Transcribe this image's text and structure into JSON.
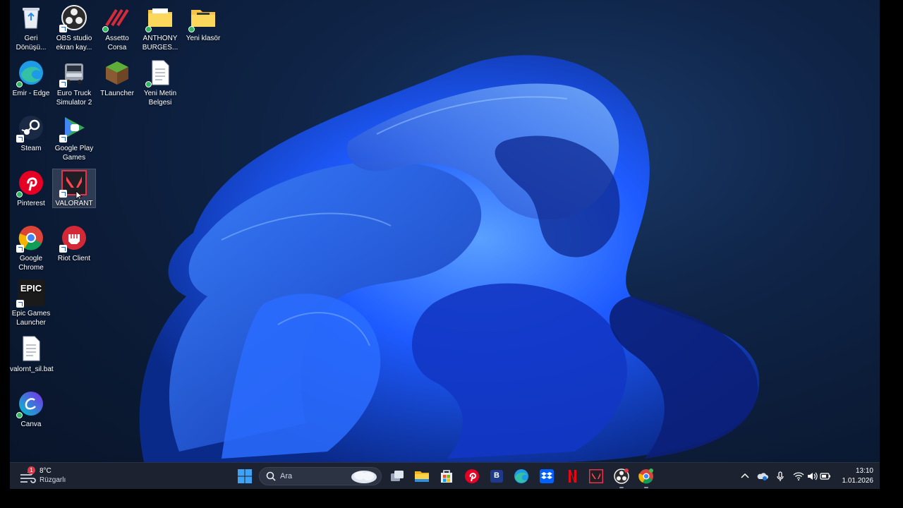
{
  "desktop": {
    "icons": [
      {
        "label": "Geri Dönüşü..."
      },
      {
        "label": "OBS studio ekran kay..."
      },
      {
        "label": "Assetto Corsa"
      },
      {
        "label": "ANTHONY BURGES..."
      },
      {
        "label": "Yeni klasör"
      },
      {
        "label": "Emir - Edge"
      },
      {
        "label": "Euro Truck Simulator 2"
      },
      {
        "label": "TLauncher"
      },
      {
        "label": "Yeni Metin Belgesi"
      },
      {
        "label": "Steam"
      },
      {
        "label": "Google Play Games"
      },
      {
        "label": "Pinterest"
      },
      {
        "label": "VALORANT"
      },
      {
        "label": "Google Chrome"
      },
      {
        "label": "Riot Client"
      },
      {
        "label": "Epic Games Launcher"
      },
      {
        "label": "valornt_sil.bat"
      },
      {
        "label": "Canva"
      }
    ]
  },
  "taskbar": {
    "weather": {
      "temp": "8°C",
      "condition": "Rüzgarlı",
      "badge": "1"
    },
    "search": {
      "placeholder": "Ara"
    },
    "epic_logo_text": "EPIC",
    "pinned_badge": "B",
    "clock": {
      "time": "13:10",
      "date": "1.01.2026"
    }
  },
  "colors": {
    "taskbar_bg": "#1c2230",
    "wallpaper_blue": "#1e5bff",
    "accent": "#0078d4"
  }
}
